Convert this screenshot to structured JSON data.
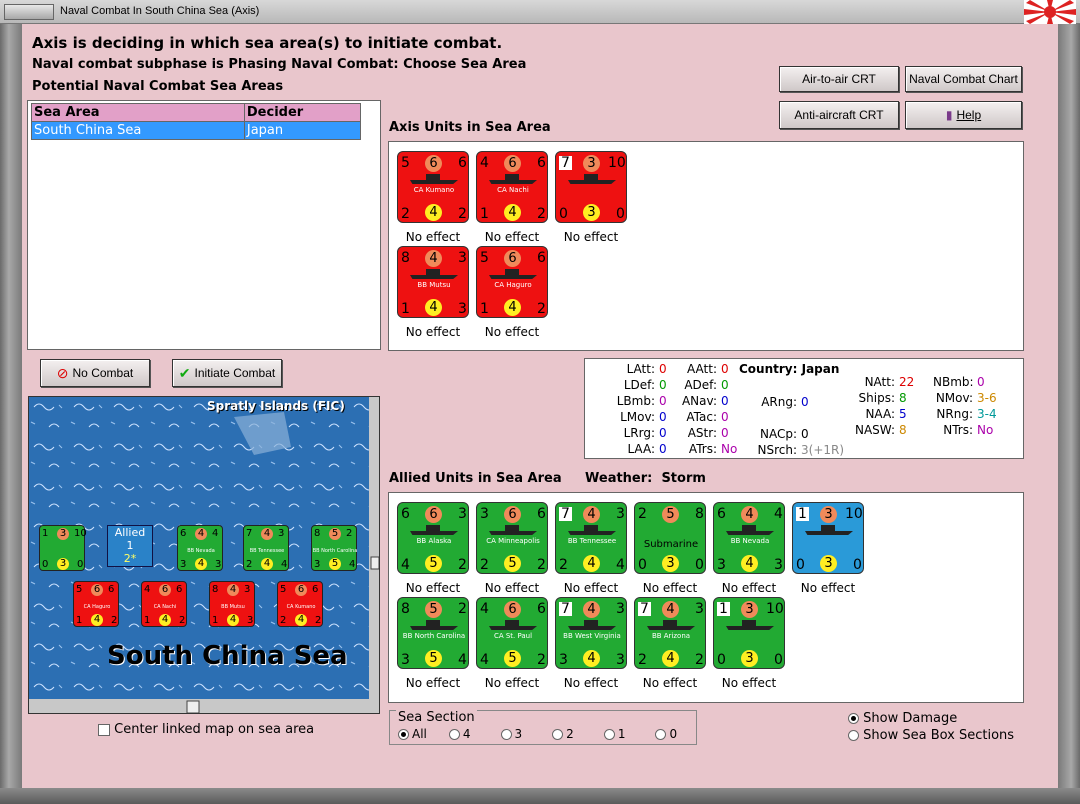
{
  "window": {
    "title": "Naval Combat In South China Sea (Axis)"
  },
  "header": {
    "line1": "Axis is deciding in which sea area(s) to initiate combat.",
    "line2": "Naval combat subphase is Phasing Naval Combat: Choose Sea Area",
    "line3": "Potential Naval Combat Sea Areas"
  },
  "buttons": {
    "air_to_air": "Air-to-air CRT",
    "naval_chart": "Naval Combat Chart",
    "anti_aircraft": "Anti-aircraft CRT",
    "help": "Help",
    "no_combat": "No Combat",
    "initiate": "Initiate Combat"
  },
  "sea_table": {
    "headers": [
      "Sea Area",
      "Decider"
    ],
    "rows": [
      [
        "South China Sea",
        "Japan"
      ]
    ]
  },
  "axis_section": "Axis Units in Sea Area",
  "allied_section": "Allied Units in Sea Area",
  "weather_label": "Weather:",
  "weather_value": "Storm",
  "axis_units": [
    {
      "tl": "5",
      "tc": "6",
      "tr": "6",
      "name": "CA Kumano",
      "bl": "2",
      "bc": "4",
      "br": "2",
      "label": "No effect"
    },
    {
      "tl": "4",
      "tc": "6",
      "tr": "6",
      "name": "CA Nachi",
      "bl": "1",
      "bc": "4",
      "br": "2",
      "label": "No effect"
    },
    {
      "tl": "7",
      "tc": "3",
      "tr": "10",
      "name": "",
      "bl": "0",
      "bc": "3",
      "br": "0",
      "label": "No effect"
    },
    {
      "tl": "8",
      "tc": "4",
      "tr": "3",
      "name": "BB Mutsu",
      "bl": "1",
      "bc": "4",
      "br": "3",
      "label": "No effect"
    },
    {
      "tl": "5",
      "tc": "6",
      "tr": "6",
      "name": "CA Haguro",
      "bl": "1",
      "bc": "4",
      "br": "2",
      "label": "No effect"
    }
  ],
  "allied_units": [
    {
      "tl": "6",
      "tc": "6",
      "tr": "3",
      "name": "BB Alaska",
      "bl": "4",
      "bc": "5",
      "br": "2",
      "label": "No effect"
    },
    {
      "tl": "3",
      "tc": "6",
      "tr": "6",
      "name": "CA Minneapolis",
      "bl": "2",
      "bc": "5",
      "br": "2",
      "label": "No effect"
    },
    {
      "tl": "7",
      "tc": "4",
      "tr": "3",
      "name": "BB Tennessee",
      "bl": "2",
      "bc": "4",
      "br": "4",
      "label": "No effect"
    },
    {
      "tl": "2",
      "tc": "5",
      "tr": "8",
      "name": "Submarine",
      "bl": "0",
      "bc": "3",
      "br": "0",
      "label": "No effect"
    },
    {
      "tl": "6",
      "tc": "4",
      "tr": "4",
      "name": "BB Nevada",
      "bl": "3",
      "bc": "4",
      "br": "3",
      "label": "No effect"
    },
    {
      "tl": "1",
      "tc": "3",
      "tr": "10",
      "name": "",
      "bl": "0",
      "bc": "3",
      "br": "0",
      "label": "No effect"
    },
    {
      "tl": "8",
      "tc": "5",
      "tr": "2",
      "name": "BB North Carolina",
      "bl": "3",
      "bc": "5",
      "br": "4",
      "label": "No effect"
    },
    {
      "tl": "4",
      "tc": "6",
      "tr": "6",
      "name": "CA St. Paul",
      "bl": "4",
      "bc": "5",
      "br": "2",
      "label": "No effect"
    },
    {
      "tl": "7",
      "tc": "4",
      "tr": "3",
      "name": "BB West Virginia",
      "bl": "3",
      "bc": "4",
      "br": "3",
      "label": "No effect"
    },
    {
      "tl": "7",
      "tc": "4",
      "tr": "3",
      "name": "BB Arizona",
      "bl": "2",
      "bc": "4",
      "br": "2",
      "label": "No effect"
    },
    {
      "tl": "1",
      "tc": "3",
      "tr": "10",
      "name": "",
      "bl": "0",
      "bc": "3",
      "br": "0",
      "label": "No effect"
    }
  ],
  "stats": {
    "country_label": "Country:",
    "country": "Japan",
    "col1": [
      [
        "LAtt:",
        "0"
      ],
      [
        "LDef:",
        "0"
      ],
      [
        "LBmb:",
        "0"
      ],
      [
        "LMov:",
        "0"
      ],
      [
        "LRrg:",
        "0"
      ],
      [
        "LAA:",
        "0"
      ]
    ],
    "col2": [
      [
        "AAtt:",
        "0"
      ],
      [
        "ADef:",
        "0"
      ],
      [
        "ANav:",
        "0"
      ],
      [
        "ATac:",
        "0"
      ],
      [
        "AStr:",
        "0"
      ],
      [
        "ATrs:",
        "No"
      ]
    ],
    "col3": [
      [
        "ARng:",
        "0"
      ],
      [
        "NACp:",
        "0"
      ],
      [
        "NSrch:",
        "3(+1R)"
      ]
    ],
    "col4": [
      [
        "NAtt:",
        "22"
      ],
      [
        "Ships:",
        "8"
      ],
      [
        "NAA:",
        "5"
      ],
      [
        "NASW:",
        "8"
      ]
    ],
    "col5": [
      [
        "NBmb:",
        "0"
      ],
      [
        "NMov:",
        "3-6"
      ],
      [
        "NRng:",
        "3-4"
      ],
      [
        "NTrs:",
        "No"
      ]
    ]
  },
  "map": {
    "islands": "Spratly Islands (FIC)",
    "sea": "South China Sea",
    "allied_box": "Allied",
    "allied_count": "1",
    "allied_sub": "2*"
  },
  "center_map": "Center linked map on sea area",
  "sea_section": {
    "title": "Sea Section",
    "options": [
      "All",
      "4",
      "3",
      "2",
      "1",
      "0"
    ]
  },
  "show_damage": "Show Damage",
  "show_sections": "Show Sea Box Sections",
  "colors": {
    "background": "#e9c6cc",
    "axis": "#ee1111",
    "allied": "#22aa33",
    "selected_row": "#3399ff"
  }
}
